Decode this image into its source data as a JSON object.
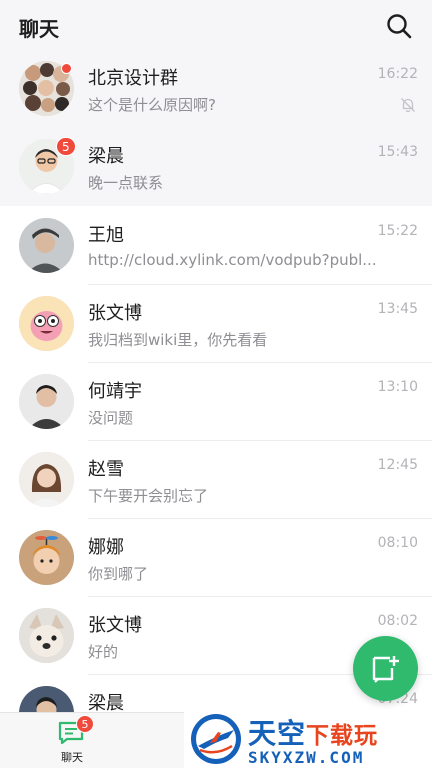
{
  "header": {
    "title": "聊天",
    "search_icon": "search-icon"
  },
  "conversations": [
    {
      "name": "北京设计群",
      "message": "这个是什么原因啊?",
      "time": "16:22",
      "pinned": true,
      "muted": true,
      "unread_dot": true
    },
    {
      "name": "梁晨",
      "message": "晚一点联系",
      "time": "15:43",
      "pinned": true,
      "badge": "5"
    },
    {
      "name": "王旭",
      "message": "http://cloud.xylink.com/vodpub?publ...",
      "time": "15:22"
    },
    {
      "name": "张文博",
      "message": "我归档到wiki里，你先看看",
      "time": "13:45"
    },
    {
      "name": "何靖宇",
      "message": "没问题",
      "time": "13:10"
    },
    {
      "name": "赵雪",
      "message": "下午要开会别忘了",
      "time": "12:45"
    },
    {
      "name": "娜娜",
      "message": "你到哪了",
      "time": "08:10"
    },
    {
      "name": "张文博",
      "message": "好的",
      "time": "08:02"
    },
    {
      "name": "梁晨",
      "message": "",
      "time": "07:24"
    }
  ],
  "fab": {
    "icon": "new-chat-icon"
  },
  "tabbar": {
    "chat_label": "聊天",
    "chat_badge": "5"
  },
  "watermark": {
    "main_a": "天空",
    "main_b": "下载玩",
    "sub": "SKYXZW.COM"
  },
  "colors": {
    "accent": "#2fba6e",
    "badge": "#f04a3c",
    "header_bg": "#f6f6f8",
    "watermark_blue": "#1560b8",
    "watermark_orange": "#e8441e"
  }
}
